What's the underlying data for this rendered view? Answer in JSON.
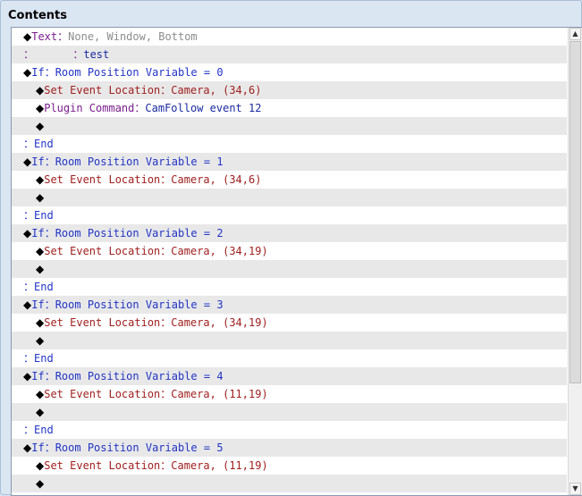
{
  "panel": {
    "title": "Contents"
  },
  "scrollbar": {
    "up_icon": "▲",
    "down_icon": "▼"
  },
  "rows": [
    {
      "indent": 0,
      "diamond": "◆",
      "parts": [
        {
          "t": "Text",
          "c": "c-text"
        },
        {
          "t": "：",
          "c": "c-text"
        },
        {
          "t": "None, Window, Bottom",
          "c": "c-gray"
        }
      ]
    },
    {
      "indent": 0,
      "diamond": "",
      "parts": [
        {
          "t": "：      ：",
          "c": "c-text"
        },
        {
          "t": "test",
          "c": "c-navy"
        }
      ]
    },
    {
      "indent": 0,
      "diamond": "◆",
      "parts": [
        {
          "t": "If",
          "c": "c-blue"
        },
        {
          "t": "：",
          "c": "c-blue"
        },
        {
          "t": "Room Position Variable = 0",
          "c": "c-blue"
        }
      ]
    },
    {
      "indent": 1,
      "diamond": "◆",
      "parts": [
        {
          "t": "Set Event Location",
          "c": "c-red"
        },
        {
          "t": "：",
          "c": "c-red"
        },
        {
          "t": "Camera, (34,6)",
          "c": "c-red"
        }
      ]
    },
    {
      "indent": 1,
      "diamond": "◆",
      "parts": [
        {
          "t": "Plugin Command",
          "c": "c-purple"
        },
        {
          "t": "：",
          "c": "c-purple"
        },
        {
          "t": "CamFollow event 12",
          "c": "c-navy"
        }
      ]
    },
    {
      "indent": 1,
      "diamond": "◆",
      "parts": []
    },
    {
      "indent": 0,
      "diamond": "",
      "parts": [
        {
          "t": "：End",
          "c": "c-blue"
        }
      ]
    },
    {
      "indent": 0,
      "diamond": "◆",
      "parts": [
        {
          "t": "If",
          "c": "c-blue"
        },
        {
          "t": "：",
          "c": "c-blue"
        },
        {
          "t": "Room Position Variable = 1",
          "c": "c-blue"
        }
      ]
    },
    {
      "indent": 1,
      "diamond": "◆",
      "parts": [
        {
          "t": "Set Event Location",
          "c": "c-red"
        },
        {
          "t": "：",
          "c": "c-red"
        },
        {
          "t": "Camera, (34,6)",
          "c": "c-red"
        }
      ]
    },
    {
      "indent": 1,
      "diamond": "◆",
      "parts": []
    },
    {
      "indent": 0,
      "diamond": "",
      "parts": [
        {
          "t": "：End",
          "c": "c-blue"
        }
      ]
    },
    {
      "indent": 0,
      "diamond": "◆",
      "parts": [
        {
          "t": "If",
          "c": "c-blue"
        },
        {
          "t": "：",
          "c": "c-blue"
        },
        {
          "t": "Room Position Variable = 2",
          "c": "c-blue"
        }
      ]
    },
    {
      "indent": 1,
      "diamond": "◆",
      "parts": [
        {
          "t": "Set Event Location",
          "c": "c-red"
        },
        {
          "t": "：",
          "c": "c-red"
        },
        {
          "t": "Camera, (34,19)",
          "c": "c-red"
        }
      ]
    },
    {
      "indent": 1,
      "diamond": "◆",
      "parts": []
    },
    {
      "indent": 0,
      "diamond": "",
      "parts": [
        {
          "t": "：End",
          "c": "c-blue"
        }
      ]
    },
    {
      "indent": 0,
      "diamond": "◆",
      "parts": [
        {
          "t": "If",
          "c": "c-blue"
        },
        {
          "t": "：",
          "c": "c-blue"
        },
        {
          "t": "Room Position Variable = 3",
          "c": "c-blue"
        }
      ]
    },
    {
      "indent": 1,
      "diamond": "◆",
      "parts": [
        {
          "t": "Set Event Location",
          "c": "c-red"
        },
        {
          "t": "：",
          "c": "c-red"
        },
        {
          "t": "Camera, (34,19)",
          "c": "c-red"
        }
      ]
    },
    {
      "indent": 1,
      "diamond": "◆",
      "parts": []
    },
    {
      "indent": 0,
      "diamond": "",
      "parts": [
        {
          "t": "：End",
          "c": "c-blue"
        }
      ]
    },
    {
      "indent": 0,
      "diamond": "◆",
      "parts": [
        {
          "t": "If",
          "c": "c-blue"
        },
        {
          "t": "：",
          "c": "c-blue"
        },
        {
          "t": "Room Position Variable = 4",
          "c": "c-blue"
        }
      ]
    },
    {
      "indent": 1,
      "diamond": "◆",
      "parts": [
        {
          "t": "Set Event Location",
          "c": "c-red"
        },
        {
          "t": "：",
          "c": "c-red"
        },
        {
          "t": "Camera, (11,19)",
          "c": "c-red"
        }
      ]
    },
    {
      "indent": 1,
      "diamond": "◆",
      "parts": []
    },
    {
      "indent": 0,
      "diamond": "",
      "parts": [
        {
          "t": "：End",
          "c": "c-blue"
        }
      ]
    },
    {
      "indent": 0,
      "diamond": "◆",
      "parts": [
        {
          "t": "If",
          "c": "c-blue"
        },
        {
          "t": "：",
          "c": "c-blue"
        },
        {
          "t": "Room Position Variable = 5",
          "c": "c-blue"
        }
      ]
    },
    {
      "indent": 1,
      "diamond": "◆",
      "parts": [
        {
          "t": "Set Event Location",
          "c": "c-red"
        },
        {
          "t": "：",
          "c": "c-red"
        },
        {
          "t": "Camera, (11,19)",
          "c": "c-red"
        }
      ]
    },
    {
      "indent": 1,
      "diamond": "◆",
      "parts": []
    }
  ]
}
